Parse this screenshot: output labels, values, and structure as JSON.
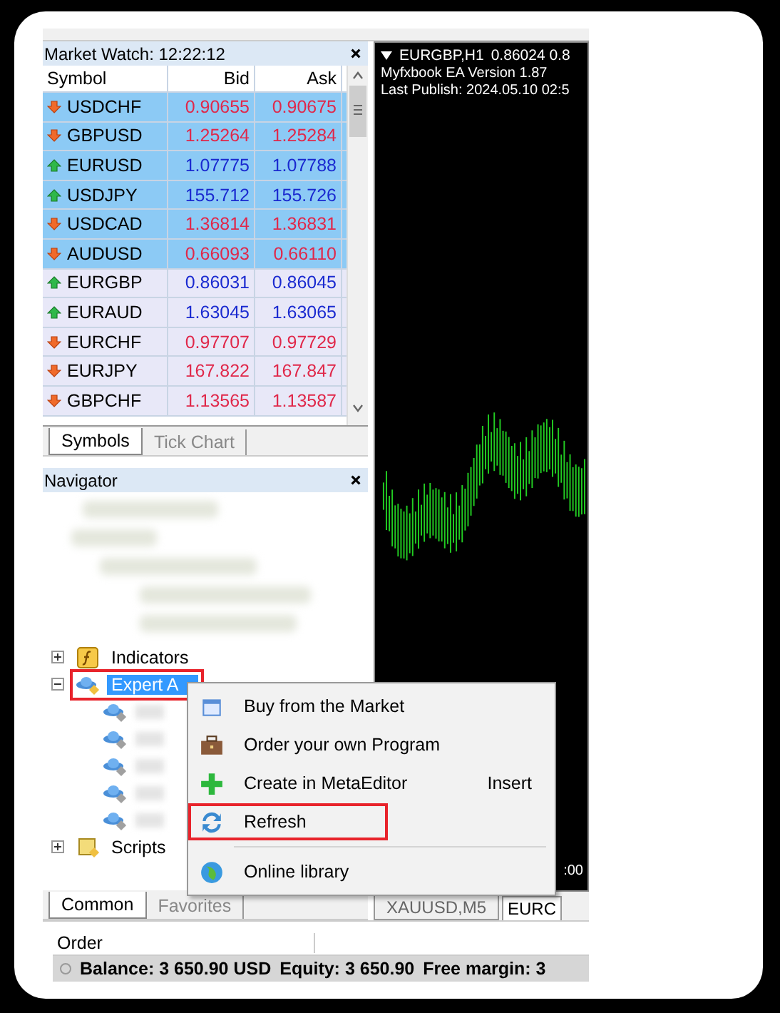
{
  "market_watch": {
    "title": "Market Watch: 12:22:12",
    "columns": [
      "Symbol",
      "Bid",
      "Ask"
    ],
    "rows": [
      {
        "symbol": "USDCHF",
        "bid": "0.90655",
        "ask": "0.90675",
        "kind": "down",
        "selected": true
      },
      {
        "symbol": "GBPUSD",
        "bid": "1.25264",
        "ask": "1.25284",
        "kind": "down",
        "selected": true
      },
      {
        "symbol": "EURUSD",
        "bid": "1.07775",
        "ask": "1.07788",
        "kind": "up",
        "selected": true
      },
      {
        "symbol": "USDJPY",
        "bid": "155.712",
        "ask": "155.726",
        "kind": "up",
        "selected": true
      },
      {
        "symbol": "USDCAD",
        "bid": "1.36814",
        "ask": "1.36831",
        "kind": "down",
        "selected": true
      },
      {
        "symbol": "AUDUSD",
        "bid": "0.66093",
        "ask": "0.66110",
        "kind": "down",
        "selected": true
      },
      {
        "symbol": "EURGBP",
        "bid": "0.86031",
        "ask": "0.86045",
        "kind": "up",
        "selected": false
      },
      {
        "symbol": "EURAUD",
        "bid": "1.63045",
        "ask": "1.63065",
        "kind": "up",
        "selected": false
      },
      {
        "symbol": "EURCHF",
        "bid": "0.97707",
        "ask": "0.97729",
        "kind": "down",
        "selected": false
      },
      {
        "symbol": "EURJPY",
        "bid": "167.822",
        "ask": "167.847",
        "kind": "down",
        "selected": false
      },
      {
        "symbol": "GBPCHF",
        "bid": "1.13565",
        "ask": "1.13587",
        "kind": "down",
        "selected": false
      }
    ],
    "tabs": [
      {
        "label": "Symbols",
        "selected": true
      },
      {
        "label": "Tick Chart",
        "selected": false
      }
    ]
  },
  "navigator": {
    "title": "Navigator",
    "items": [
      {
        "label": "Indicators",
        "kind": "indicator",
        "expanded": false,
        "selected": false,
        "highlighted": false
      },
      {
        "label": "Expert A",
        "kind": "expert",
        "expanded": true,
        "selected": true,
        "highlighted": true
      },
      {
        "label": "Scripts",
        "kind": "script",
        "expanded": false,
        "selected": false,
        "highlighted": false
      }
    ],
    "tabs": [
      {
        "label": "Common",
        "selected": true
      },
      {
        "label": "Favorites",
        "selected": false
      }
    ]
  },
  "chart": {
    "symbol": "EURGBP,H1",
    "prices": "0.86024 0.8",
    "lines": [
      "Myfxbook EA Version 1.87",
      "Last Publish: 2024.05.10 02:5"
    ],
    "time_label": ":00",
    "tabs": [
      {
        "label": "XAUUSD,M5",
        "selected": false
      },
      {
        "label": "EURC",
        "selected": true
      }
    ]
  },
  "context_menu": [
    {
      "kind": "market",
      "label": "Buy from the Market",
      "highlighted": false
    },
    {
      "kind": "order",
      "label": "Order your own Program",
      "highlighted": false
    },
    {
      "kind": "create",
      "label": "Create in MetaEditor",
      "shortcut": "Insert",
      "highlighted": false
    },
    {
      "kind": "refresh",
      "label": "Refresh",
      "highlighted": true
    },
    {
      "kind": "separator"
    },
    {
      "kind": "library",
      "label": "Online library",
      "highlighted": false
    }
  ],
  "terminal": {
    "column": "Order",
    "balance": "Balance: 3 650.90 USD",
    "equity": "Equity: 3 650.90",
    "free_margin": "Free margin: 3"
  }
}
